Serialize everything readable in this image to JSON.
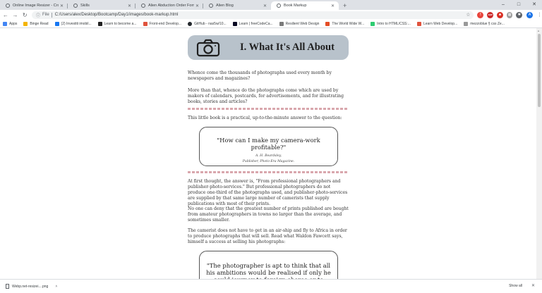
{
  "browser": {
    "tabs": [
      {
        "label": "Online Image Resizer - Crop, Re..."
      },
      {
        "label": "Skills"
      },
      {
        "label": "Alien Abduction Order Form"
      },
      {
        "label": "Alien Blog"
      },
      {
        "label": "Book Markup",
        "active": true
      }
    ],
    "new_tab_glyph": "+",
    "window_controls": {
      "minimize": "–",
      "maximize": "□",
      "close": "✕"
    },
    "url_prefix": "File",
    "url": "C:/Users/alex/Desktop/Bootcamp/Day1/images/book-markup.html",
    "profile_initial": "A",
    "extensions": [
      {
        "name": "shield-ext-icon",
        "color": "#e8453c",
        "glyph": "!"
      },
      {
        "name": "adblock-ext-icon",
        "color": "#cc2a2a",
        "glyph": "ABP"
      },
      {
        "name": "stop-ext-icon",
        "color": "#d93025",
        "glyph": "■"
      },
      {
        "name": "grid-ext-icon",
        "color": "#9e9e9e",
        "glyph": "▦"
      },
      {
        "name": "puzzle-ext-icon",
        "color": "#5f6368",
        "glyph": "✱"
      }
    ]
  },
  "bookmarks": [
    {
      "label": "Apps",
      "color": "#4285f4"
    },
    {
      "label": "Binge Read",
      "color": "#f4b400"
    },
    {
      "label": "(2) Investiti imobil...",
      "color": "#1877f2"
    },
    {
      "label": "Learn to become a...",
      "color": "#222222"
    },
    {
      "label": "Front-end Develop...",
      "color": "#e0533d"
    },
    {
      "label": "GitHub - nas5w/10...",
      "color": "#24292e"
    },
    {
      "label": "Learn | freeCodeCa...",
      "color": "#0a0a23"
    },
    {
      "label": "Resilient Web Design",
      "color": "#7a7a7a"
    },
    {
      "label": "The World Wide W...",
      "color": "#e44d26"
    },
    {
      "label": "Intro to HTML/CSS:...",
      "color": "#2ecc71"
    },
    {
      "label": "Learn Web Develop...",
      "color": "#e0533d"
    },
    {
      "label": "mezzoblue § css Ze...",
      "color": "#999999"
    }
  ],
  "page": {
    "heading": "I. What It's All About",
    "paragraphs": [
      "Whence come the thousands of photographs used every month by newspapers and magazines?",
      "More than that, whence do the photographs come which are used by makers of calendars, postcards, for advertisements, and for illustrating books, stories and articles?",
      "This little book is a practical, up-to-the-minute answer to the question:",
      "At first thought, the answer is, \"From professional photographers and publisher-photo-services.\" But professional photographers do not produce one-third of the photographs used, and publisher-photo-services are supplied by that same large number of camerists that supply publications with most of their prints.",
      "No one can deny that the greatest number of prints published are bought from amateur photographers in towns no larger than the average, and sometimes smaller.",
      "The camerist does not have to get in an air-ship and fly to Africa in order to produce photographs that will sell. Read what Waldon Fawcett says, himself a success at selling his photographs:"
    ],
    "quote1": {
      "text": "\"How can I make my camera-work profitable?\"",
      "author": "A. H. Beardsley,",
      "role": "Publisher, Photo-Era Magazine."
    },
    "quote2": {
      "text": "\"The photographer is apt to think that all his ambitions would be realised if only he could journey to foreign shores or to distant corners of our country; or if he"
    }
  },
  "downloads": {
    "file": "Webp.net-resizei....png",
    "show_all": "Show all"
  }
}
